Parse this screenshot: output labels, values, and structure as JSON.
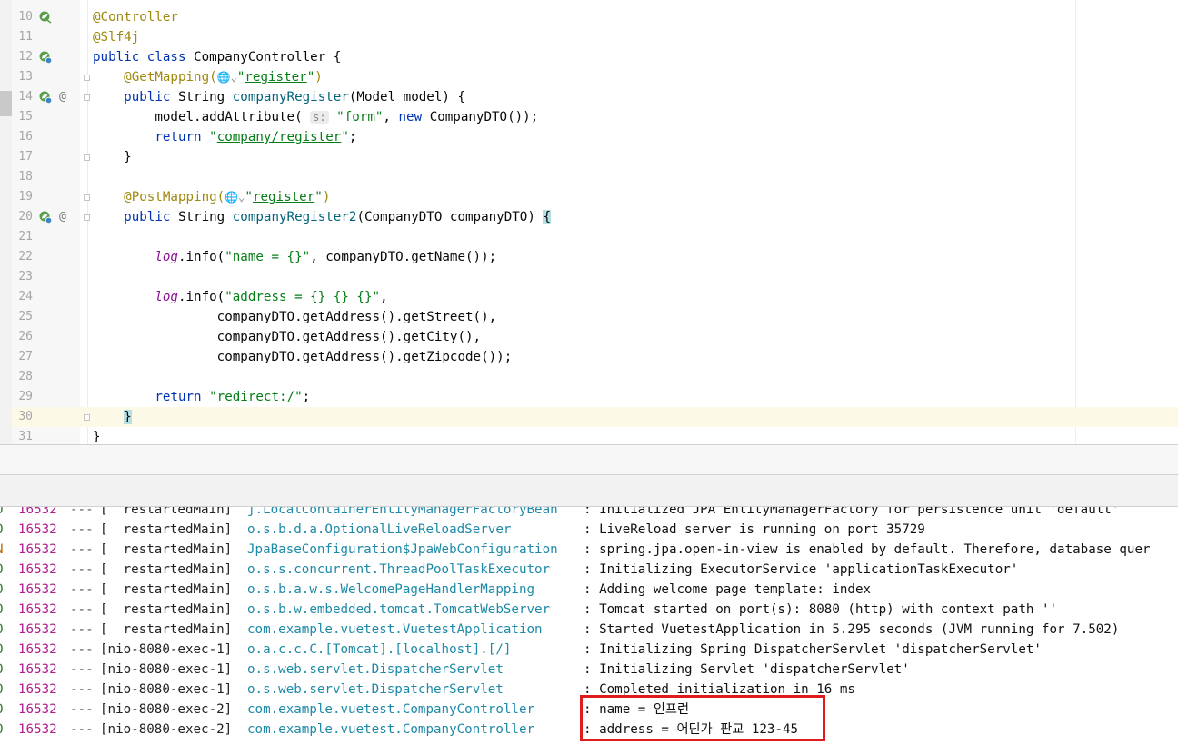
{
  "editor": {
    "lines": [
      {
        "n": "10",
        "icon": "leaf",
        "segs": [
          [
            "ann",
            "@Controller"
          ]
        ]
      },
      {
        "n": "11",
        "segs": [
          [
            "ann",
            "@Slf4j"
          ]
        ]
      },
      {
        "n": "12",
        "icon": "leaf-globe",
        "segs": [
          [
            "kw",
            "public class "
          ],
          [
            "",
            "CompanyController {"
          ]
        ]
      },
      {
        "n": "13",
        "segs": [
          [
            "",
            "    "
          ],
          [
            "ann",
            "@GetMapping("
          ],
          [
            "globe",
            "🌐⌄"
          ],
          [
            "str",
            "\""
          ],
          [
            "strul",
            "register"
          ],
          [
            "str",
            "\""
          ],
          [
            "ann",
            ")"
          ]
        ]
      },
      {
        "n": "14",
        "icon": "leaf-globe",
        "at": true,
        "segs": [
          [
            "",
            "    "
          ],
          [
            "kw",
            "public "
          ],
          [
            "",
            "String "
          ],
          [
            "meth",
            "companyRegister"
          ],
          [
            "",
            "(Model model) {"
          ]
        ]
      },
      {
        "n": "15",
        "segs": [
          [
            "",
            "        model.addAttribute( "
          ],
          [
            "hint",
            "s:"
          ],
          [
            "str",
            " \"form\""
          ],
          [
            "",
            ", "
          ],
          [
            "kw",
            "new "
          ],
          [
            "",
            "CompanyDTO());"
          ]
        ]
      },
      {
        "n": "16",
        "segs": [
          [
            "",
            "        "
          ],
          [
            "kw",
            "return "
          ],
          [
            "str",
            "\""
          ],
          [
            "strul",
            "company/register"
          ],
          [
            "str",
            "\""
          ],
          [
            "",
            ";"
          ]
        ]
      },
      {
        "n": "17",
        "segs": [
          [
            "",
            "    }"
          ]
        ]
      },
      {
        "n": "18",
        "segs": []
      },
      {
        "n": "19",
        "segs": [
          [
            "",
            "    "
          ],
          [
            "ann",
            "@PostMapping("
          ],
          [
            "globe",
            "🌐⌄"
          ],
          [
            "str",
            "\""
          ],
          [
            "strul",
            "register"
          ],
          [
            "str",
            "\""
          ],
          [
            "ann",
            ")"
          ]
        ]
      },
      {
        "n": "20",
        "icon": "leaf-globe",
        "at": true,
        "segs": [
          [
            "",
            "    "
          ],
          [
            "kw",
            "public "
          ],
          [
            "",
            "String "
          ],
          [
            "meth",
            "companyRegister2"
          ],
          [
            "",
            "(CompanyDTO companyDTO) "
          ],
          [
            "bracehl",
            "{"
          ]
        ]
      },
      {
        "n": "21",
        "segs": []
      },
      {
        "n": "22",
        "segs": [
          [
            "",
            "        "
          ],
          [
            "log",
            "log"
          ],
          [
            "",
            ".info("
          ],
          [
            "str",
            "\"name = {}\""
          ],
          [
            "",
            ", companyDTO.getName());"
          ]
        ]
      },
      {
        "n": "23",
        "segs": []
      },
      {
        "n": "24",
        "segs": [
          [
            "",
            "        "
          ],
          [
            "log",
            "log"
          ],
          [
            "",
            ".info("
          ],
          [
            "str",
            "\"address = {} {} {}\""
          ],
          [
            "",
            ","
          ]
        ]
      },
      {
        "n": "25",
        "segs": [
          [
            "",
            "                companyDTO.getAddress().getStreet(),"
          ]
        ]
      },
      {
        "n": "26",
        "segs": [
          [
            "",
            "                companyDTO.getAddress().getCity(),"
          ]
        ]
      },
      {
        "n": "27",
        "segs": [
          [
            "",
            "                companyDTO.getAddress().getZipcode());"
          ]
        ]
      },
      {
        "n": "28",
        "segs": []
      },
      {
        "n": "29",
        "segs": [
          [
            "",
            "        "
          ],
          [
            "kw",
            "return "
          ],
          [
            "str",
            "\"redirect:"
          ],
          [
            "strul",
            "/"
          ],
          [
            "str",
            "\""
          ],
          [
            "",
            ";"
          ]
        ]
      },
      {
        "n": "30",
        "current": true,
        "segs": [
          [
            "",
            "    "
          ],
          [
            "bracehl",
            "}"
          ]
        ]
      },
      {
        "n": "31",
        "segs": [
          [
            "",
            "}"
          ]
        ]
      }
    ]
  },
  "console": {
    "lines": [
      {
        "lv": "O",
        "pid": "16532",
        "sep": "---",
        "thr": "[  restartedMain]",
        "cls": "j.LocalContainerEntityManagerFactoryBean",
        "msg": ": Initialized JPA EntityManagerFactory for persistence unit 'default'"
      },
      {
        "lv": "O",
        "pid": "16532",
        "sep": "---",
        "thr": "[  restartedMain]",
        "cls": "o.s.b.d.a.OptionalLiveReloadServer",
        "msg": ": LiveReload server is running on port 35729"
      },
      {
        "lv": "N",
        "pid": "16532",
        "sep": "---",
        "thr": "[  restartedMain]",
        "cls": "JpaBaseConfiguration$JpaWebConfiguration",
        "msg": ": spring.jpa.open-in-view is enabled by default. Therefore, database quer"
      },
      {
        "lv": "O",
        "pid": "16532",
        "sep": "---",
        "thr": "[  restartedMain]",
        "cls": "o.s.s.concurrent.ThreadPoolTaskExecutor",
        "msg": ": Initializing ExecutorService 'applicationTaskExecutor'"
      },
      {
        "lv": "O",
        "pid": "16532",
        "sep": "---",
        "thr": "[  restartedMain]",
        "cls": "o.s.b.a.w.s.WelcomePageHandlerMapping",
        "msg": ": Adding welcome page template: index"
      },
      {
        "lv": "O",
        "pid": "16532",
        "sep": "---",
        "thr": "[  restartedMain]",
        "cls": "o.s.b.w.embedded.tomcat.TomcatWebServer",
        "msg": ": Tomcat started on port(s): 8080 (http) with context path ''"
      },
      {
        "lv": "O",
        "pid": "16532",
        "sep": "---",
        "thr": "[  restartedMain]",
        "cls": "com.example.vuetest.VuetestApplication",
        "msg": ": Started VuetestApplication in 5.295 seconds (JVM running for 7.502)"
      },
      {
        "lv": "O",
        "pid": "16532",
        "sep": "---",
        "thr": "[nio-8080-exec-1]",
        "cls": "o.a.c.c.C.[Tomcat].[localhost].[/]",
        "msg": ": Initializing Spring DispatcherServlet 'dispatcherServlet'"
      },
      {
        "lv": "O",
        "pid": "16532",
        "sep": "---",
        "thr": "[nio-8080-exec-1]",
        "cls": "o.s.web.servlet.DispatcherServlet",
        "msg": ": Initializing Servlet 'dispatcherServlet'"
      },
      {
        "lv": "O",
        "pid": "16532",
        "sep": "---",
        "thr": "[nio-8080-exec-1]",
        "cls": "o.s.web.servlet.DispatcherServlet",
        "msg": ": Completed initialization in 16 ms"
      },
      {
        "lv": "O",
        "pid": "16532",
        "sep": "---",
        "thr": "[nio-8080-exec-2]",
        "cls": "com.example.vuetest.CompanyController",
        "msg": ": name = 인프런"
      },
      {
        "lv": "O",
        "pid": "16532",
        "sep": "---",
        "thr": "[nio-8080-exec-2]",
        "cls": "com.example.vuetest.CompanyController",
        "msg": ": address = 어딘가 판교 123-45"
      }
    ]
  },
  "colors": {
    "highlight_box": "#e01b1b",
    "keyword": "#0033b3",
    "annotation": "#9e880d",
    "string": "#067d17"
  }
}
